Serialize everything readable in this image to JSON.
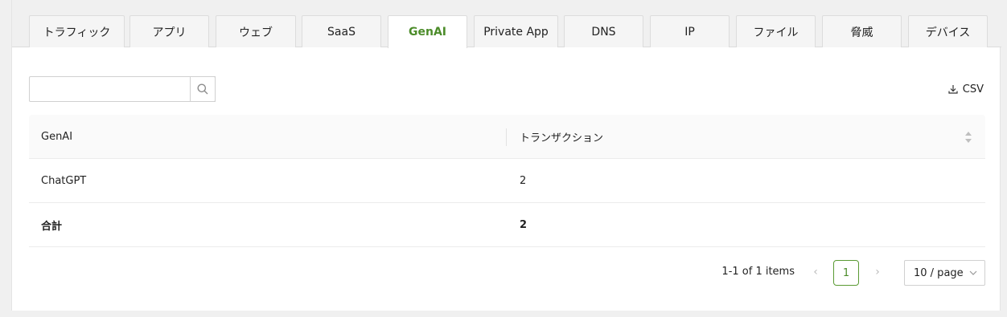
{
  "tabs": [
    {
      "label": "トラフィック",
      "active": false
    },
    {
      "label": "アプリ",
      "active": false
    },
    {
      "label": "ウェブ",
      "active": false
    },
    {
      "label": "SaaS",
      "active": false
    },
    {
      "label": "GenAI",
      "active": true
    },
    {
      "label": "Private App",
      "active": false
    },
    {
      "label": "DNS",
      "active": false
    },
    {
      "label": "IP",
      "active": false
    },
    {
      "label": "ファイル",
      "active": false
    },
    {
      "label": "脅威",
      "active": false
    },
    {
      "label": "デバイス",
      "active": false
    }
  ],
  "search": {
    "value": "",
    "placeholder": ""
  },
  "toolbar": {
    "csv_label": "CSV"
  },
  "table": {
    "columns": [
      "GenAI",
      "トランザクション"
    ],
    "rows": [
      {
        "name": "ChatGPT",
        "transactions": "2"
      }
    ],
    "total": {
      "name": "合計",
      "transactions": "2"
    }
  },
  "pagination": {
    "info": "1-1 of 1 items",
    "current_page": "1",
    "page_size": "10 / page"
  },
  "colors": {
    "accent": "#4c8c2a"
  }
}
